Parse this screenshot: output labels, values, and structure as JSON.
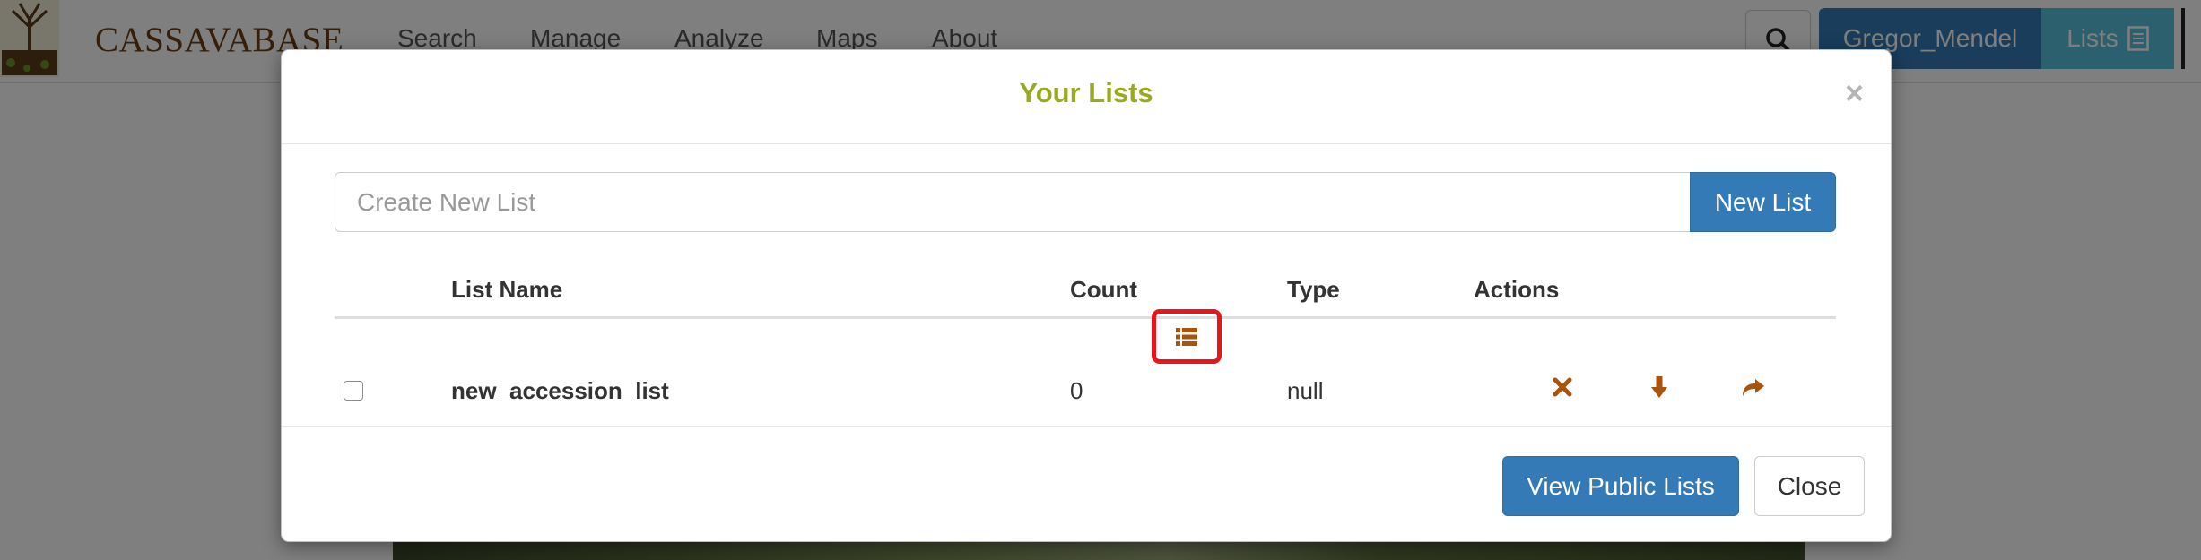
{
  "navbar": {
    "brand": "CASSAVABASE",
    "links": [
      "Search",
      "Manage",
      "Analyze",
      "Maps",
      "About"
    ],
    "user_button": "Gregor_Mendel",
    "lists_button": "Lists"
  },
  "modal": {
    "title": "Your Lists",
    "close_symbol": "×",
    "new_list_placeholder": "Create New List",
    "new_list_button": "New List",
    "table": {
      "headers": {
        "name": "List Name",
        "count": "Count",
        "type": "Type",
        "actions": "Actions"
      },
      "rows": [
        {
          "name": "new_accession_list",
          "count": "0",
          "type": "null",
          "actions": [
            "list-view-icon",
            "delete-icon",
            "download-icon",
            "share-icon"
          ]
        }
      ]
    },
    "footer": {
      "view_public_button": "View Public Lists",
      "close_button": "Close"
    }
  },
  "colors": {
    "title": "#9aaa1f",
    "primary": "#337ab7",
    "action_icon": "#a9530c",
    "highlight": "#e8141e"
  }
}
